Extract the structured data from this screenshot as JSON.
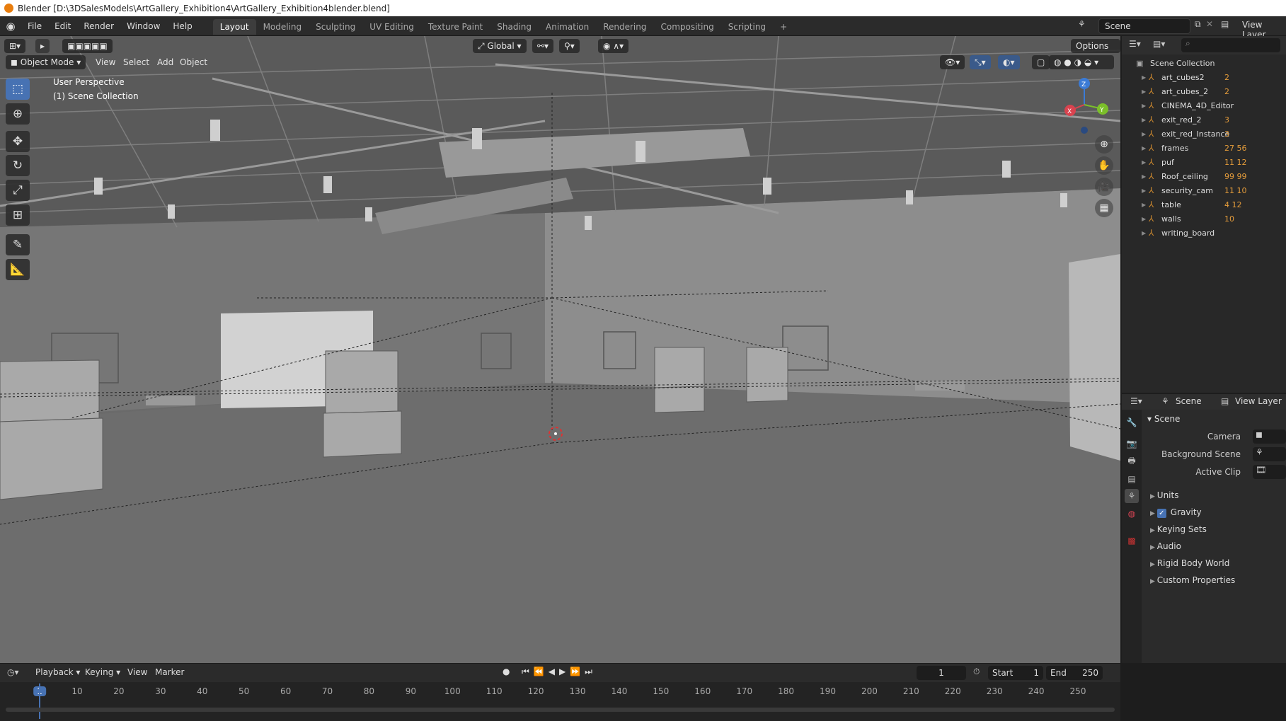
{
  "window_title": "Blender [D:\\3DSalesModels\\ArtGallery_Exhibition4\\ArtGallery_Exhibition4blender.blend]",
  "menus": [
    "File",
    "Edit",
    "Render",
    "Window",
    "Help"
  ],
  "workspace_tabs": [
    "Layout",
    "Modeling",
    "Sculpting",
    "UV Editing",
    "Texture Paint",
    "Shading",
    "Animation",
    "Rendering",
    "Compositing",
    "Scripting"
  ],
  "active_workspace": "Layout",
  "scene_field": "Scene",
  "view_layer_field": "View Layer",
  "viewport": {
    "mode": "Object Mode",
    "menus": [
      "View",
      "Select",
      "Add",
      "Object"
    ],
    "transform_orientation": "Global",
    "options_label": "Options",
    "overlay_title": "User Perspective",
    "overlay_subtitle": "(1) Scene Collection",
    "gizmo_axes": {
      "x": "X",
      "y": "Y",
      "z": "Z"
    }
  },
  "outliner": {
    "root": "Scene Collection",
    "items": [
      {
        "name": "art_cubes2",
        "badge": "2"
      },
      {
        "name": "art_cubes_2",
        "badge": "2"
      },
      {
        "name": "CINEMA_4D_Editor",
        "badge": ""
      },
      {
        "name": "exit_red_2",
        "badge": "3"
      },
      {
        "name": "exit_red_Instance",
        "badge": "3"
      },
      {
        "name": "frames",
        "badge": "27  56"
      },
      {
        "name": "puf",
        "badge": "11  12"
      },
      {
        "name": "Roof_ceiling",
        "badge": "99  99"
      },
      {
        "name": "security_cam",
        "badge": "11  10"
      },
      {
        "name": "table",
        "badge": "4  12"
      },
      {
        "name": "walls",
        "badge": "10"
      },
      {
        "name": "writing_board",
        "badge": ""
      }
    ]
  },
  "properties": {
    "header_scene": "Scene",
    "header_view_layer": "View Layer",
    "section": "Scene",
    "fields": [
      {
        "label": "Camera"
      },
      {
        "label": "Background Scene"
      },
      {
        "label": "Active Clip"
      }
    ],
    "panels": [
      "Units",
      "Gravity",
      "Keying Sets",
      "Audio",
      "Rigid Body World",
      "Custom Properties"
    ],
    "gravity_checked": true
  },
  "timeline": {
    "menus": [
      "Playback",
      "Keying",
      "View",
      "Marker"
    ],
    "current_frame": "1",
    "start_label": "Start",
    "start_value": "1",
    "end_label": "End",
    "end_value": "250",
    "ticks": [
      "1",
      "10",
      "20",
      "30",
      "40",
      "50",
      "60",
      "70",
      "80",
      "90",
      "100",
      "110",
      "120",
      "130",
      "140",
      "150",
      "160",
      "170",
      "180",
      "190",
      "200",
      "210",
      "220",
      "230",
      "240",
      "250"
    ]
  },
  "colors": {
    "accent": "#4772b3",
    "outliner_icon": "#c8862e",
    "header_bg": "#2b2b2b",
    "viewport_bg": "#6a6a6a"
  }
}
